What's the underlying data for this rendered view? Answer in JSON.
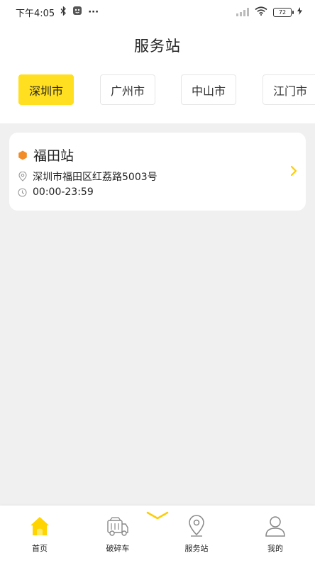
{
  "status_bar": {
    "time": "下午4:05",
    "dots": "···",
    "battery": "72"
  },
  "header": {
    "title": "服务站"
  },
  "cities": [
    {
      "label": "深圳市",
      "active": true
    },
    {
      "label": "广州市",
      "active": false
    },
    {
      "label": "中山市",
      "active": false
    },
    {
      "label": "江门市",
      "active": false
    }
  ],
  "station": {
    "name": "福田站",
    "address": "深圳市福田区红荔路5003号",
    "hours": "00:00-23:59"
  },
  "tab_bar": {
    "items": [
      {
        "label": "首页",
        "icon": "home-icon",
        "active": true
      },
      {
        "label": "破碎车",
        "icon": "truck-icon",
        "active": false
      },
      {
        "label": "服务站",
        "icon": "location-pin-icon",
        "active": false
      },
      {
        "label": "我的",
        "icon": "user-icon",
        "active": false
      }
    ]
  },
  "colors": {
    "accent": "#ffdf1f",
    "marker": "#f28c28",
    "icon_gray": "#888888"
  }
}
